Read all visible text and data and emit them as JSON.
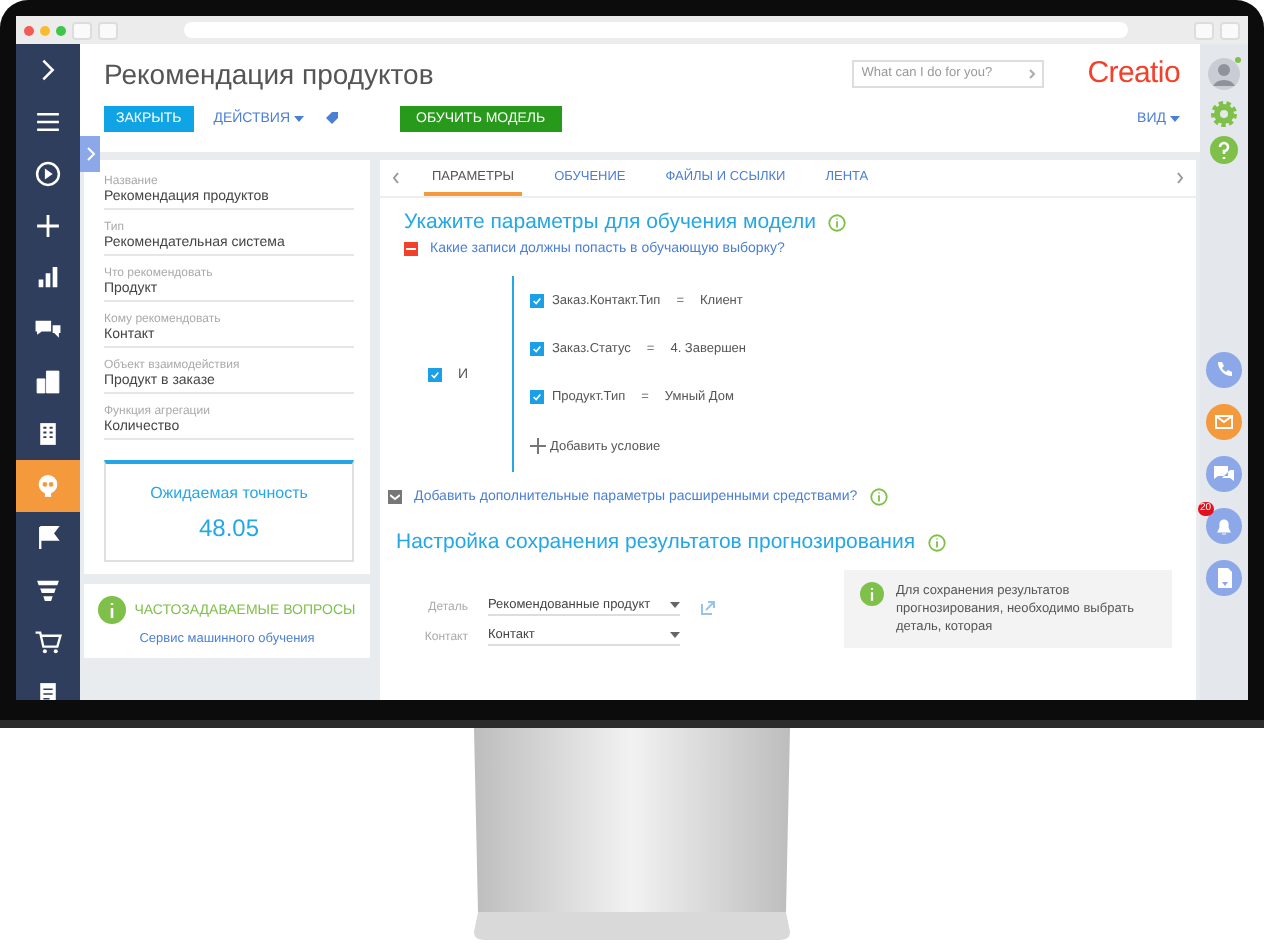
{
  "nav": {
    "items": [
      {
        "selected": false
      },
      {
        "selected": false
      },
      {
        "selected": false
      },
      {
        "selected": false
      },
      {
        "selected": false
      },
      {
        "selected": false
      },
      {
        "selected": false
      },
      {
        "selected": false
      },
      {
        "selected": true
      },
      {
        "selected": false
      },
      {
        "selected": false
      },
      {
        "selected": false
      },
      {
        "selected": false
      }
    ]
  },
  "header": {
    "title": "Рекомендация продуктов",
    "close_button": "ЗАКРЫТЬ",
    "actions_button": "ДЕЙСТВИЯ",
    "train_button": "ОБУЧИТЬ МОДЕЛЬ",
    "search": {
      "placeholder": "What can I do for you?"
    },
    "logo": "Creatio",
    "view_button": "ВИД"
  },
  "fields": [
    {
      "label": "Название",
      "value": "Рекомендация продуктов"
    },
    {
      "label": "Тип",
      "value": "Рекомендательная система"
    },
    {
      "label": "Что рекомендовать",
      "value": "Продукт"
    },
    {
      "label": "Кому рекомендовать",
      "value": "Контакт"
    },
    {
      "label": "Объект взаимодействия",
      "value": "Продукт в заказе"
    },
    {
      "label": "Функция агрегации",
      "value": "Количество"
    }
  ],
  "accuracy": {
    "title": "Ожидаемая точность",
    "value": "48.05"
  },
  "faq": {
    "title": "ЧАСТОЗАДАВАЕМЫЕ ВОПРОСЫ",
    "link": "Сервис машинного обучения"
  },
  "tabs": [
    {
      "label": "ПАРАМЕТРЫ",
      "selected": true
    },
    {
      "label": "ОБУЧЕНИЕ",
      "selected": false
    },
    {
      "label": "ФАЙЛЫ И ССЫЛКИ",
      "selected": false
    },
    {
      "label": "ЛЕНТА",
      "selected": false
    }
  ],
  "params": {
    "heading": "Укажите параметры для обучения модели",
    "question": {
      "label": "Какие записи должны попасть в обучающую выборку?",
      "expanded": true
    },
    "group": {
      "operator": "И",
      "checked": true,
      "conditions": [
        {
          "field": "Заказ.Контакт.Тип",
          "op": "=",
          "value": "Клиент",
          "checked": true
        },
        {
          "field": "Заказ.Статус",
          "op": "=",
          "value": "4. Завершен",
          "checked": true
        },
        {
          "field": "Продукт.Тип",
          "op": "=",
          "value": "Умный Дом",
          "checked": true
        }
      ],
      "add": "Добавить условие"
    },
    "advanced": {
      "label": "Добавить дополнительные параметры расширенными средствами?",
      "expanded": false
    }
  },
  "save": {
    "heading": "Настройка сохранения результатов прогнозирования",
    "fields": [
      {
        "label": "Деталь",
        "value": "Рекомендованные продукт"
      },
      {
        "label": "Контакт",
        "value": "Контакт"
      }
    ],
    "info": "Для сохранения результатов прогнозирования, необходимо выбрать деталь, которая"
  },
  "rail": {
    "notifications": "20"
  }
}
